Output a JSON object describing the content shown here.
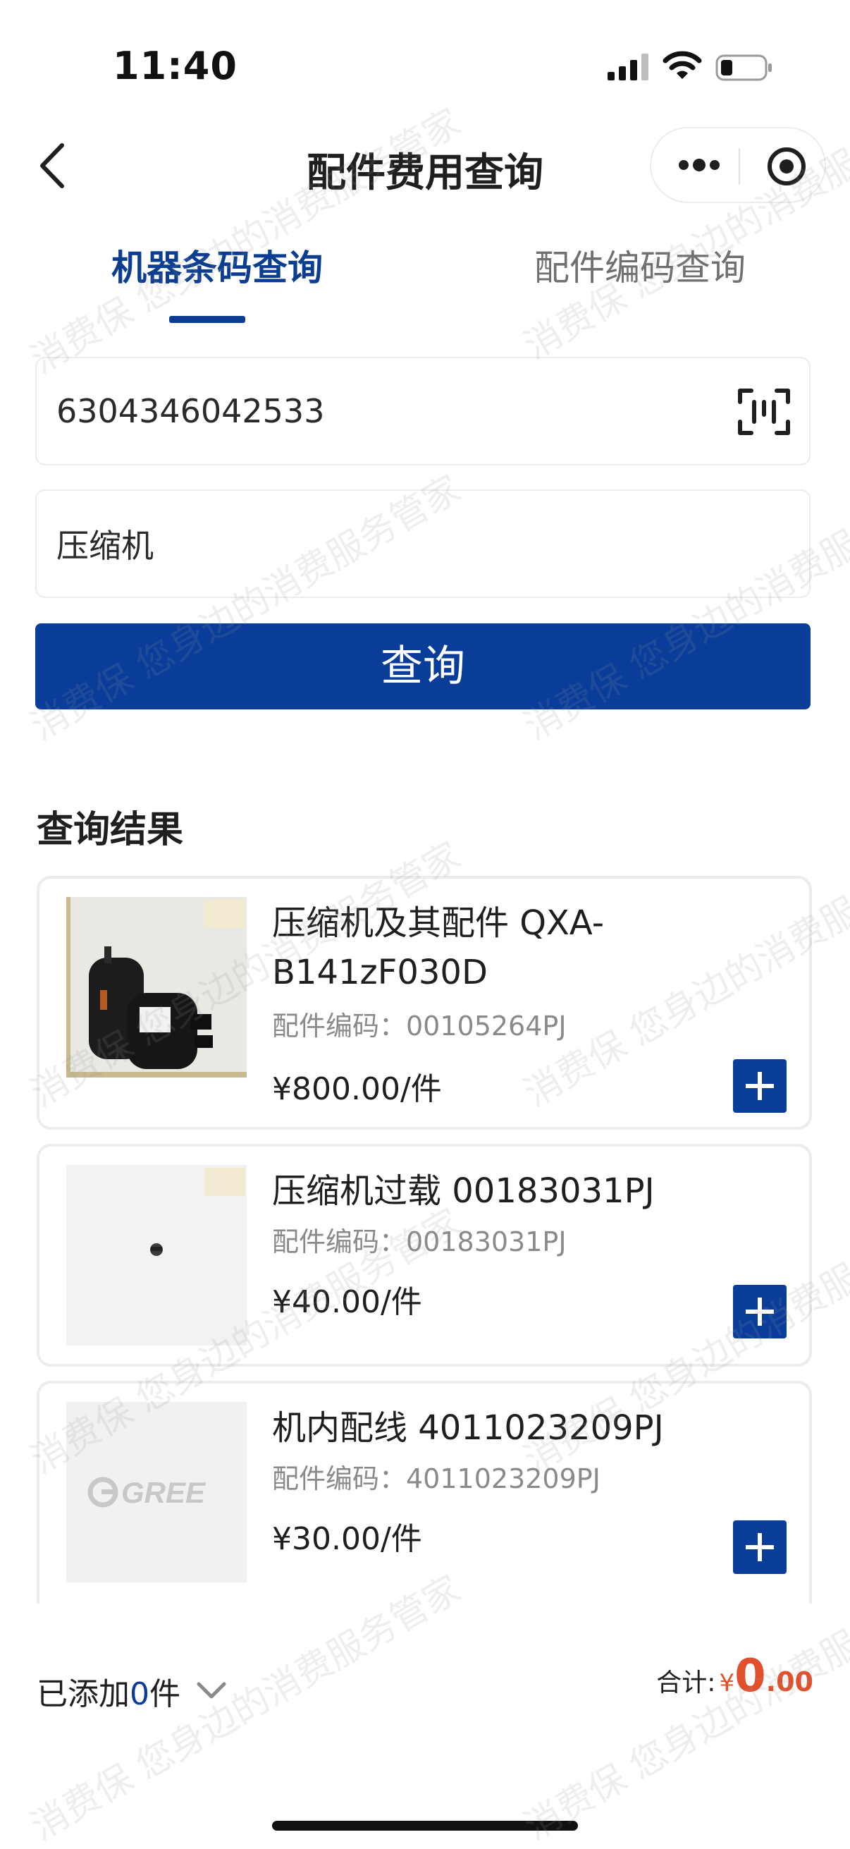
{
  "status_bar": {
    "time": "11:40"
  },
  "nav": {
    "title": "配件费用查询"
  },
  "tabs": [
    {
      "label": "机器条码查询",
      "active": true
    },
    {
      "label": "配件编码查询",
      "active": false
    }
  ],
  "search": {
    "barcode_value": "6304346042533",
    "keyword_value": "压缩机",
    "button_label": "查询"
  },
  "results": {
    "title": "查询结果",
    "items": [
      {
        "name": "压缩机及其配件 QXA-B141zF030D",
        "code": "配件编码：00105264PJ",
        "price": "¥800.00/件",
        "thumb_icon": "compressor-photo"
      },
      {
        "name": "压缩机过载 00183031PJ",
        "code": "配件编码：00183031PJ",
        "price": "¥40.00/件",
        "thumb_icon": "overload-part-photo"
      },
      {
        "name": "机内配线 4011023209PJ",
        "code": "配件编码：4011023209PJ",
        "price": "¥30.00/件",
        "thumb_icon": "gree-logo-placeholder",
        "logo_text": "GREE"
      }
    ]
  },
  "cart": {
    "prefix": "已添加",
    "count": "0",
    "suffix": "件"
  },
  "total": {
    "label": "合计:",
    "currency": "¥",
    "integer": "0",
    "decimal": ".00"
  },
  "watermark": {
    "text": "消费保 您身边的消费服务管家"
  },
  "colors": {
    "primary": "#0a3d9a",
    "price_total": "#e0502c",
    "code_gray": "#8a8a8a"
  }
}
